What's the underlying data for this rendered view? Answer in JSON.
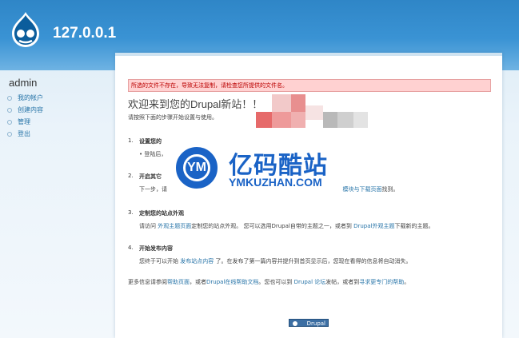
{
  "header": {
    "site_name": "127.0.0.1",
    "logo_icon": "drupal-drop-icon"
  },
  "sidebar": {
    "user": "admin",
    "items": [
      {
        "label": "我的帐户"
      },
      {
        "label": "创建内容"
      },
      {
        "label": "管理"
      },
      {
        "label": "登出"
      }
    ]
  },
  "main": {
    "error_message": "所选的文件不存在，导致无法复制，请检查您所提供的文件名。",
    "title": "欢迎来到您的Drupal新站！！",
    "intro": "请按照下面的步骤开始设置与使用。",
    "steps": [
      {
        "num": "1.",
        "head": "设置您的",
        "body_prefix": "登陆后，"
      },
      {
        "num": "2.",
        "head": "开启其它",
        "body_prefix": "下一步，请",
        "link": "模块与下载页面",
        "body_suffix": "找到。"
      },
      {
        "num": "3.",
        "head": "定制您的站点外观",
        "body_prefix": "请访问",
        "link": "外观主题页面",
        "body_mid": "定制您的站点外观。 您可以选用Drupal自带的主题之一，或者到",
        "link2": "Drupal外观主题",
        "body_suffix": "下载新的主题。"
      },
      {
        "num": "4.",
        "head": "开始发布内容",
        "body_prefix": "您终于可以开始",
        "link": "发布站点内容",
        "body_suffix": "了。在发布了第一篇内容并提升到首页显示后，您现在看得的信息将自动消失。"
      }
    ],
    "footer": {
      "prefix": "更多信息请参阅",
      "link1": "帮助页面",
      "mid1": "，或者",
      "link2": "Drupal在线帮助文档",
      "mid2": "。您也可以到 ",
      "link3": "Drupal 论坛",
      "mid3": "发帖，或者到",
      "link4": "寻求更专门的帮助",
      "suffix": "。"
    },
    "powered_by": "Drupal"
  },
  "watermark": {
    "title": "亿码酷站",
    "subtitle": "YMKUZHAN.COM",
    "badge": "YM"
  },
  "colors": {
    "header": "#3a93d4",
    "link": "#2774a8",
    "error_bg": "#ffd1d1",
    "watermark": "#1a63c6"
  }
}
